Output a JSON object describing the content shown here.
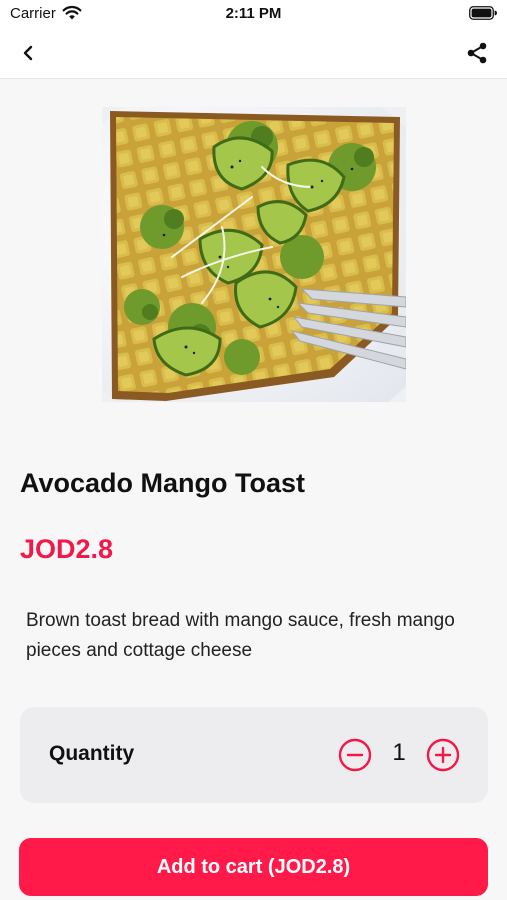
{
  "status_bar": {
    "carrier": "Carrier",
    "time": "2:11 PM"
  },
  "nav": {
    "back_icon": "chevron-left-icon",
    "share_icon": "share-icon"
  },
  "product": {
    "image": "avocado-toast-photo",
    "title": "Avocado Mango Toast",
    "price": "JOD2.8",
    "description": "Brown toast bread with mango sauce, fresh mango pieces and cottage cheese"
  },
  "quantity": {
    "label": "Quantity",
    "value": "1",
    "decrease_icon": "minus-circle-icon",
    "increase_icon": "plus-circle-icon"
  },
  "cart": {
    "button_label": "Add to cart (JOD2.8)"
  },
  "colors": {
    "accent": "#f2194a",
    "button": "#ff1a4a",
    "card": "#ededf0",
    "background": "#f7f7f8"
  }
}
